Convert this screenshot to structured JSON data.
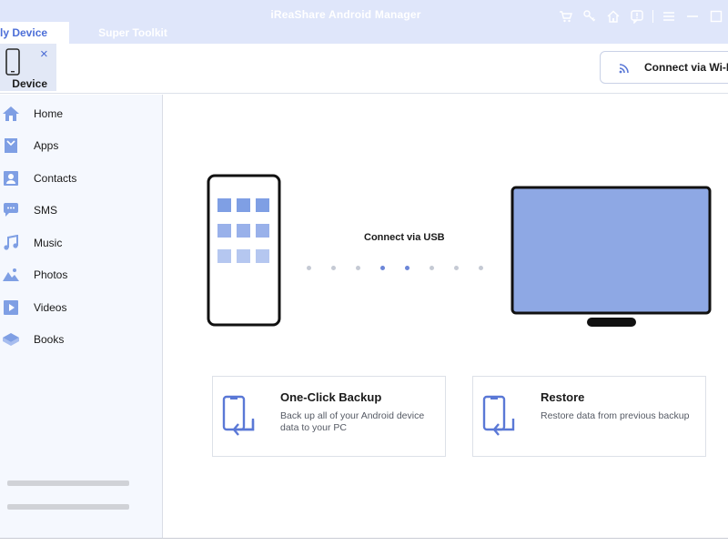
{
  "window": {
    "title": "iReaShare Android Manager",
    "tabs": [
      {
        "label": "My Device",
        "visible_label": "ly Device",
        "active": true
      },
      {
        "label": "Super Toolkit",
        "active": false
      }
    ],
    "toolbar_icons": [
      "cart-icon",
      "key-icon",
      "home-icon",
      "feedback-icon",
      "menu-icon",
      "minimize-icon"
    ]
  },
  "device": {
    "label": "Device",
    "close": "×"
  },
  "connect_wifi": {
    "label": "Connect via Wi-Fi",
    "visible_label": "Connect via Wi-F"
  },
  "sidebar": {
    "items": [
      {
        "label": "Home",
        "icon": "home-icon"
      },
      {
        "label": "Apps",
        "icon": "apps-icon"
      },
      {
        "label": "Contacts",
        "icon": "contacts-icon"
      },
      {
        "label": "SMS",
        "icon": "sms-icon"
      },
      {
        "label": "Music",
        "icon": "music-icon"
      },
      {
        "label": "Photos",
        "icon": "photos-icon"
      },
      {
        "label": "Videos",
        "icon": "videos-icon"
      },
      {
        "label": "Books",
        "icon": "books-icon"
      }
    ]
  },
  "main": {
    "connection_label": "Connect via USB",
    "progress_dots": {
      "total": 8,
      "active": [
        4,
        5
      ]
    },
    "cards": [
      {
        "title": "One-Click Backup",
        "description": "Back up all of your Android device data to your PC",
        "icon": "backup-icon"
      },
      {
        "title": "Restore",
        "description": "Restore data from previous backup",
        "icon": "restore-icon"
      }
    ]
  },
  "colors": {
    "accent": "#4d6fd8",
    "titlebar": "#dfe6fa",
    "sidebar": "#f5f8fe",
    "monitor_screen": "#8ea8e4",
    "phone_tile": "#7f9fe4"
  }
}
